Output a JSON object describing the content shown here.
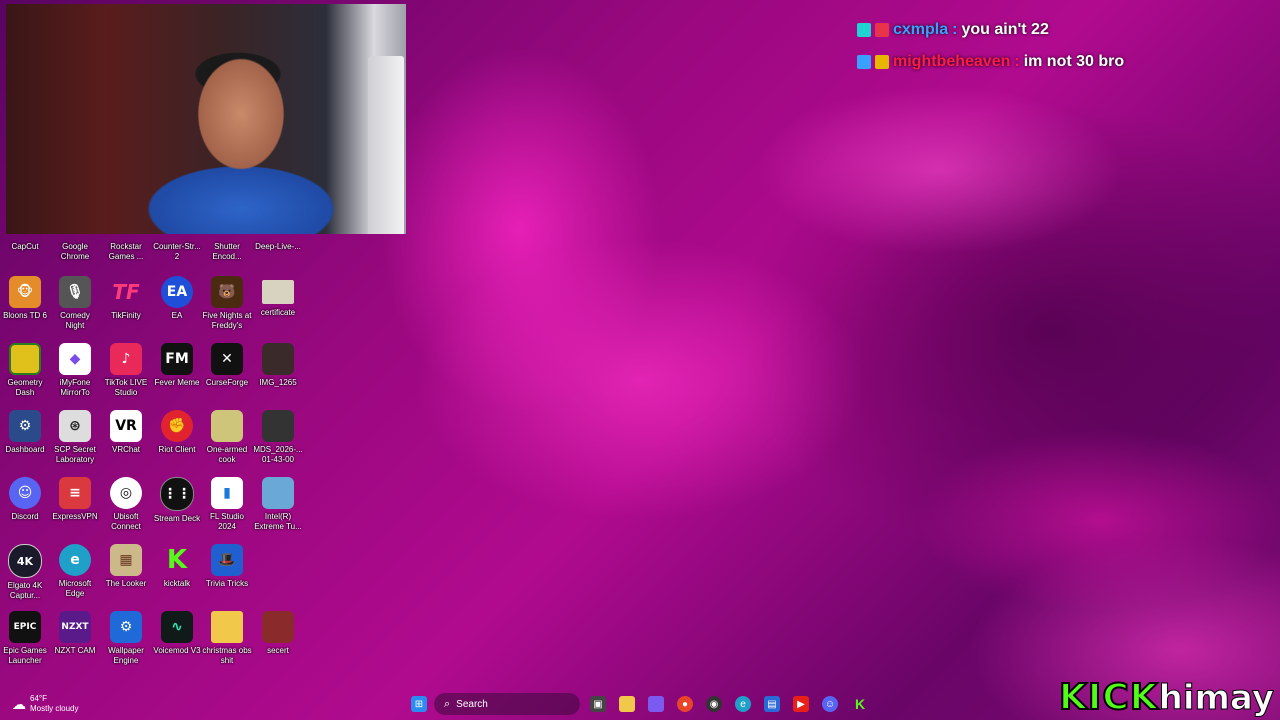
{
  "chat": {
    "messages": [
      {
        "user": "cxmpla",
        "sep": ":",
        "text": "you ain't 22",
        "user_color": "#3aa0ff"
      },
      {
        "user": "mightbeheaven",
        "sep": ":",
        "text": "im not 30 bro",
        "user_color": "#ff1a4a"
      }
    ]
  },
  "desktop": {
    "row1": [
      "CapCut",
      "Google Chrome",
      "Rockstar Games ...",
      "Counter-Str... 2",
      "Shutter Encod...",
      "Deep-Live-..."
    ],
    "rows": [
      [
        "Bloons TD 6",
        "Comedy Night",
        "TikFinity",
        "EA",
        "Five Nights at Freddy's",
        "certificate"
      ],
      [
        "Geometry Dash",
        "iMyFone MirrorTo",
        "TikTok LIVE Studio",
        "Fever Meme",
        "CurseForge",
        "IMG_1265"
      ],
      [
        "Dashboard",
        "SCP Secret Laboratory",
        "VRChat",
        "Riot Client",
        "One-armed cook",
        "MDS_2026-... 01-43-00"
      ],
      [
        "Discord",
        "ExpressVPN",
        "Ubisoft Connect",
        "Stream Deck",
        "FL Studio 2024",
        "Intel(R) Extreme Tu..."
      ],
      [
        "Elgato 4K Captur...",
        "Microsoft Edge",
        "The Looker",
        "kicktalk",
        "Trivia Tricks"
      ],
      [
        "Epic Games Launcher",
        "NZXT CAM",
        "Wallpaper Engine",
        "Voicemod V3",
        "christmas obs shit",
        "secert"
      ]
    ],
    "glyphs": {
      "TikFinity": "TF",
      "EA": "EA",
      "Fever Meme": "FM",
      "VRChat": "VR",
      "Elgato 4K Captur...": "4K",
      "Epic Games Launcher": "EPIC",
      "NZXT CAM": "NZXT",
      "kicktalk": "K"
    }
  },
  "taskbar": {
    "weather_temp": "64°F",
    "weather_desc": "Mostly cloudy",
    "search_label": "Search"
  },
  "stream": {
    "platform": "KICK",
    "channel": "himay",
    "brand_color": "#53fc18"
  }
}
